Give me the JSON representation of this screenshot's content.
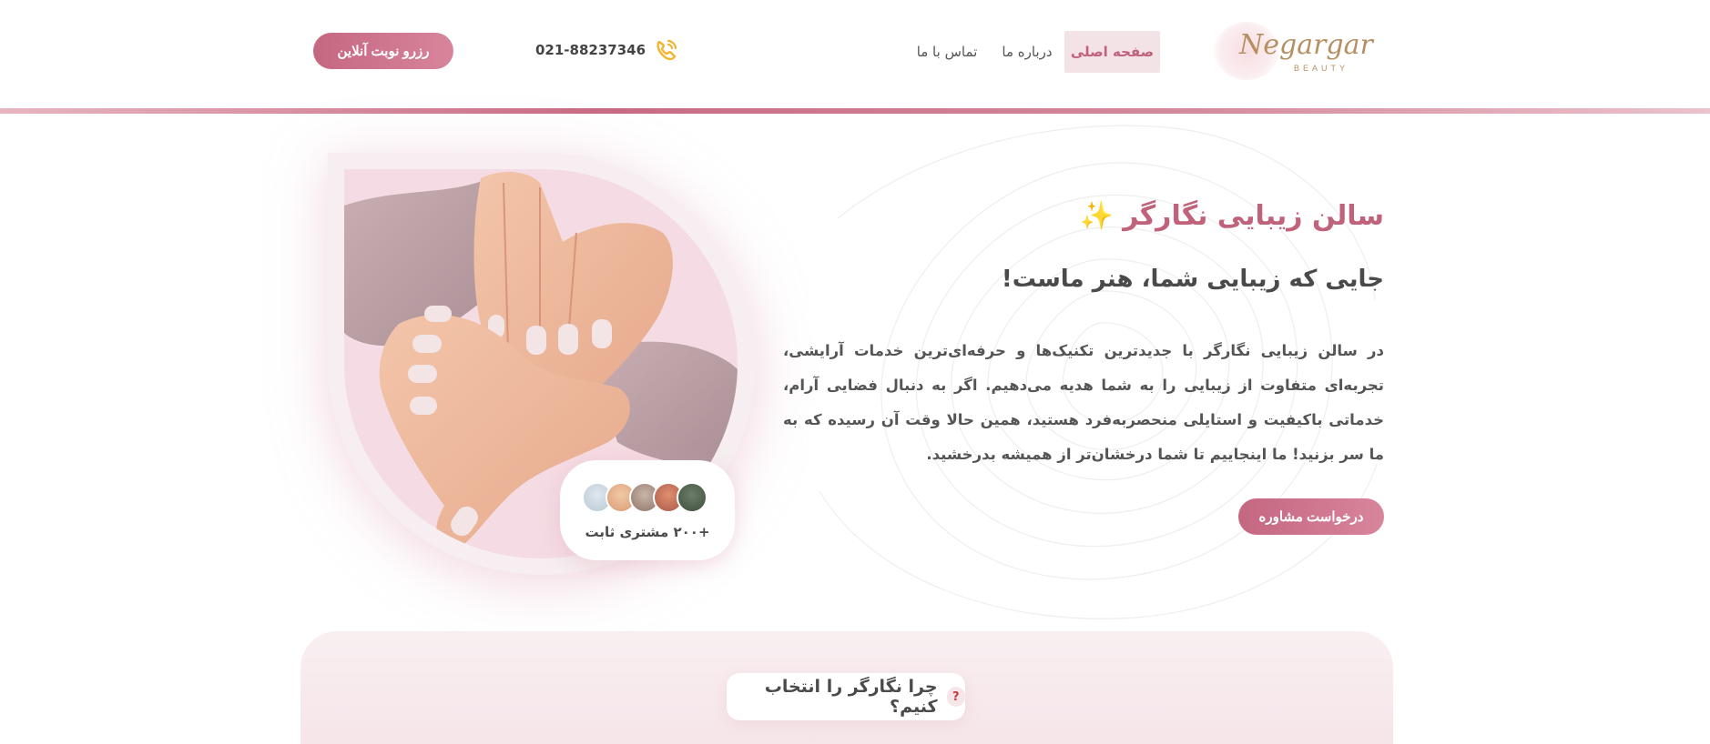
{
  "header": {
    "logo_text": "Negargar",
    "logo_subtext": "BEAUTY",
    "nav": {
      "home": "صفحه اصلی",
      "about": "درباره ما",
      "contact": "تماس با ما"
    },
    "phone": "021-88237346",
    "reserve_button": "رزرو نوبت آنلاین"
  },
  "hero": {
    "title": "سالن زیبایی نگارگر",
    "title_emoji": "✨",
    "subtitle": "جایی که زیبایی شما، هنر ماست!",
    "paragraph": "در سالن زیبایی نگارگر با جدیدترین تکنیک‌ها و حرفه‌ای‌ترین خدمات آرایشی، تجربه‌ای متفاوت از زیبایی را به شما هدیه می‌دهیم. اگر به دنبال فضایی آرام، خدماتی باکیفیت و استایلی منحصربه‌فرد هستید، همین حالا وقت آن رسیده که به ما سر بزنید! ما اینجاییم تا شما درخشان‌تر از همیشه بدرخشید.",
    "consult_button": "درخواست مشاوره",
    "clients_label": "+۲۰۰ مشتری ثابت"
  },
  "why": {
    "icon": "?",
    "title": "چرا نگارگر را انتخاب کنیم؟"
  },
  "colors": {
    "accent": "#c0627a",
    "accent_light": "#f4e3e6",
    "phone_icon": "#f2b531"
  }
}
